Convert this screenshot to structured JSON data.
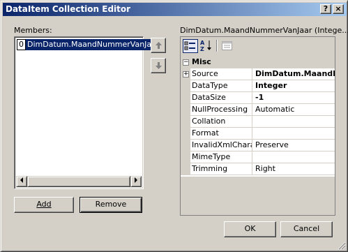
{
  "window": {
    "title": "DataItem Collection Editor",
    "help_button": "?",
    "close_button": "×"
  },
  "members": {
    "label": "Members:",
    "items": [
      {
        "index": "0",
        "name": "DimDatum.MaandNummerVanJaar"
      }
    ],
    "add_button": "Add",
    "remove_button": "Remove",
    "move_up_icon": "arrow-up-icon",
    "move_down_icon": "arrow-down-icon"
  },
  "properties": {
    "header": "DimDatum.MaandNummerVanJaar (Intege...",
    "toolbar": [
      "categorized-icon",
      "alphabetical-icon",
      "property-pages-icon"
    ],
    "category": "Misc",
    "rows": [
      {
        "name": "Source",
        "value": "DimDatum.MaandNu",
        "bold": true,
        "expandable": true
      },
      {
        "name": "DataType",
        "value": "Integer",
        "bold": true
      },
      {
        "name": "DataSize",
        "value": "-1",
        "bold": true
      },
      {
        "name": "NullProcessing",
        "value": "Automatic"
      },
      {
        "name": "Collation",
        "value": ""
      },
      {
        "name": "Format",
        "value": ""
      },
      {
        "name": "InvalidXmlCharact",
        "value": "Preserve"
      },
      {
        "name": "MimeType",
        "value": ""
      },
      {
        "name": "Trimming",
        "value": "Right"
      }
    ]
  },
  "footer": {
    "ok_button": "OK",
    "cancel_button": "Cancel"
  },
  "colors": {
    "titlebar_start": "#0a246a",
    "titlebar_end": "#a6caf0",
    "selection": "#0a246a",
    "dialog_face": "#d4d0c8"
  }
}
